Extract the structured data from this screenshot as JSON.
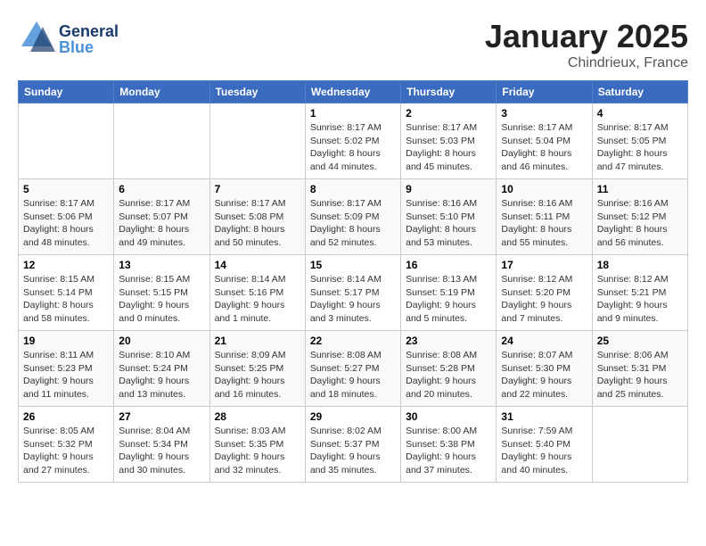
{
  "header": {
    "logo_general": "General",
    "logo_blue": "Blue",
    "month_title": "January 2025",
    "location": "Chindrieux, France"
  },
  "weekdays": [
    "Sunday",
    "Monday",
    "Tuesday",
    "Wednesday",
    "Thursday",
    "Friday",
    "Saturday"
  ],
  "weeks": [
    [
      {
        "day": "",
        "info": ""
      },
      {
        "day": "",
        "info": ""
      },
      {
        "day": "",
        "info": ""
      },
      {
        "day": "1",
        "sunrise": "Sunrise: 8:17 AM",
        "sunset": "Sunset: 5:02 PM",
        "daylight": "Daylight: 8 hours and 44 minutes."
      },
      {
        "day": "2",
        "sunrise": "Sunrise: 8:17 AM",
        "sunset": "Sunset: 5:03 PM",
        "daylight": "Daylight: 8 hours and 45 minutes."
      },
      {
        "day": "3",
        "sunrise": "Sunrise: 8:17 AM",
        "sunset": "Sunset: 5:04 PM",
        "daylight": "Daylight: 8 hours and 46 minutes."
      },
      {
        "day": "4",
        "sunrise": "Sunrise: 8:17 AM",
        "sunset": "Sunset: 5:05 PM",
        "daylight": "Daylight: 8 hours and 47 minutes."
      }
    ],
    [
      {
        "day": "5",
        "sunrise": "Sunrise: 8:17 AM",
        "sunset": "Sunset: 5:06 PM",
        "daylight": "Daylight: 8 hours and 48 minutes."
      },
      {
        "day": "6",
        "sunrise": "Sunrise: 8:17 AM",
        "sunset": "Sunset: 5:07 PM",
        "daylight": "Daylight: 8 hours and 49 minutes."
      },
      {
        "day": "7",
        "sunrise": "Sunrise: 8:17 AM",
        "sunset": "Sunset: 5:08 PM",
        "daylight": "Daylight: 8 hours and 50 minutes."
      },
      {
        "day": "8",
        "sunrise": "Sunrise: 8:17 AM",
        "sunset": "Sunset: 5:09 PM",
        "daylight": "Daylight: 8 hours and 52 minutes."
      },
      {
        "day": "9",
        "sunrise": "Sunrise: 8:16 AM",
        "sunset": "Sunset: 5:10 PM",
        "daylight": "Daylight: 8 hours and 53 minutes."
      },
      {
        "day": "10",
        "sunrise": "Sunrise: 8:16 AM",
        "sunset": "Sunset: 5:11 PM",
        "daylight": "Daylight: 8 hours and 55 minutes."
      },
      {
        "day": "11",
        "sunrise": "Sunrise: 8:16 AM",
        "sunset": "Sunset: 5:12 PM",
        "daylight": "Daylight: 8 hours and 56 minutes."
      }
    ],
    [
      {
        "day": "12",
        "sunrise": "Sunrise: 8:15 AM",
        "sunset": "Sunset: 5:14 PM",
        "daylight": "Daylight: 8 hours and 58 minutes."
      },
      {
        "day": "13",
        "sunrise": "Sunrise: 8:15 AM",
        "sunset": "Sunset: 5:15 PM",
        "daylight": "Daylight: 9 hours and 0 minutes."
      },
      {
        "day": "14",
        "sunrise": "Sunrise: 8:14 AM",
        "sunset": "Sunset: 5:16 PM",
        "daylight": "Daylight: 9 hours and 1 minute."
      },
      {
        "day": "15",
        "sunrise": "Sunrise: 8:14 AM",
        "sunset": "Sunset: 5:17 PM",
        "daylight": "Daylight: 9 hours and 3 minutes."
      },
      {
        "day": "16",
        "sunrise": "Sunrise: 8:13 AM",
        "sunset": "Sunset: 5:19 PM",
        "daylight": "Daylight: 9 hours and 5 minutes."
      },
      {
        "day": "17",
        "sunrise": "Sunrise: 8:12 AM",
        "sunset": "Sunset: 5:20 PM",
        "daylight": "Daylight: 9 hours and 7 minutes."
      },
      {
        "day": "18",
        "sunrise": "Sunrise: 8:12 AM",
        "sunset": "Sunset: 5:21 PM",
        "daylight": "Daylight: 9 hours and 9 minutes."
      }
    ],
    [
      {
        "day": "19",
        "sunrise": "Sunrise: 8:11 AM",
        "sunset": "Sunset: 5:23 PM",
        "daylight": "Daylight: 9 hours and 11 minutes."
      },
      {
        "day": "20",
        "sunrise": "Sunrise: 8:10 AM",
        "sunset": "Sunset: 5:24 PM",
        "daylight": "Daylight: 9 hours and 13 minutes."
      },
      {
        "day": "21",
        "sunrise": "Sunrise: 8:09 AM",
        "sunset": "Sunset: 5:25 PM",
        "daylight": "Daylight: 9 hours and 16 minutes."
      },
      {
        "day": "22",
        "sunrise": "Sunrise: 8:08 AM",
        "sunset": "Sunset: 5:27 PM",
        "daylight": "Daylight: 9 hours and 18 minutes."
      },
      {
        "day": "23",
        "sunrise": "Sunrise: 8:08 AM",
        "sunset": "Sunset: 5:28 PM",
        "daylight": "Daylight: 9 hours and 20 minutes."
      },
      {
        "day": "24",
        "sunrise": "Sunrise: 8:07 AM",
        "sunset": "Sunset: 5:30 PM",
        "daylight": "Daylight: 9 hours and 22 minutes."
      },
      {
        "day": "25",
        "sunrise": "Sunrise: 8:06 AM",
        "sunset": "Sunset: 5:31 PM",
        "daylight": "Daylight: 9 hours and 25 minutes."
      }
    ],
    [
      {
        "day": "26",
        "sunrise": "Sunrise: 8:05 AM",
        "sunset": "Sunset: 5:32 PM",
        "daylight": "Daylight: 9 hours and 27 minutes."
      },
      {
        "day": "27",
        "sunrise": "Sunrise: 8:04 AM",
        "sunset": "Sunset: 5:34 PM",
        "daylight": "Daylight: 9 hours and 30 minutes."
      },
      {
        "day": "28",
        "sunrise": "Sunrise: 8:03 AM",
        "sunset": "Sunset: 5:35 PM",
        "daylight": "Daylight: 9 hours and 32 minutes."
      },
      {
        "day": "29",
        "sunrise": "Sunrise: 8:02 AM",
        "sunset": "Sunset: 5:37 PM",
        "daylight": "Daylight: 9 hours and 35 minutes."
      },
      {
        "day": "30",
        "sunrise": "Sunrise: 8:00 AM",
        "sunset": "Sunset: 5:38 PM",
        "daylight": "Daylight: 9 hours and 37 minutes."
      },
      {
        "day": "31",
        "sunrise": "Sunrise: 7:59 AM",
        "sunset": "Sunset: 5:40 PM",
        "daylight": "Daylight: 9 hours and 40 minutes."
      },
      {
        "day": "",
        "info": ""
      }
    ]
  ]
}
